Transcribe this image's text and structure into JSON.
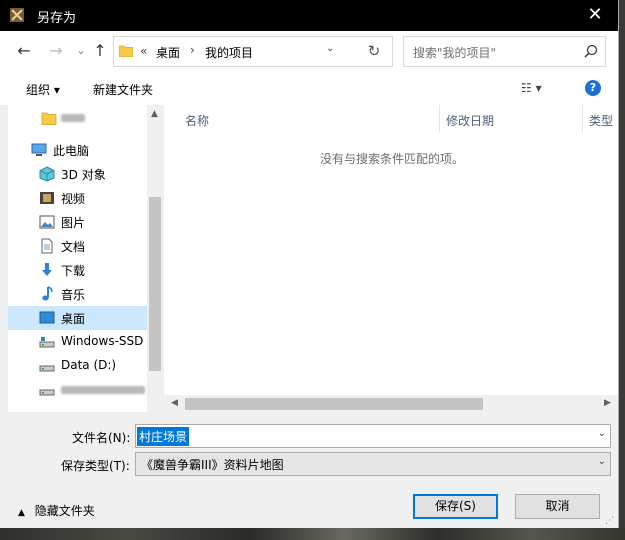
{
  "window": {
    "title": "另存为",
    "close_glyph": "✕"
  },
  "nav": {
    "back_glyph": "←",
    "forward_glyph": "→",
    "dropdown_glyph": "⌄",
    "up_glyph": "↑",
    "breadcrumb_prefix": "«",
    "crumbs": [
      "桌面",
      "我的项目"
    ],
    "crumb_sep": "›",
    "addr_dropdown_glyph": "⌄",
    "refresh_glyph": "↻",
    "search_placeholder": "搜索\"我的项目\""
  },
  "toolbar": {
    "organize": "组织 ▾",
    "new_folder": "新建文件夹",
    "view_glyph": "☷ ▾",
    "help": "?"
  },
  "sidebar": {
    "items": [
      {
        "label": "",
        "icon": "folder-icon"
      },
      {
        "label": "此电脑",
        "icon": "computer-icon"
      },
      {
        "label": "3D 对象",
        "icon": "cube-icon"
      },
      {
        "label": "视频",
        "icon": "film-icon"
      },
      {
        "label": "图片",
        "icon": "image-icon"
      },
      {
        "label": "文档",
        "icon": "document-icon"
      },
      {
        "label": "下载",
        "icon": "download-icon"
      },
      {
        "label": "音乐",
        "icon": "music-icon"
      },
      {
        "label": "桌面",
        "icon": "desktop-icon",
        "selected": true
      },
      {
        "label": "Windows-SSD",
        "icon": "drive-icon"
      },
      {
        "label": "Data (D:)",
        "icon": "drive-icon"
      },
      {
        "label": "",
        "icon": "drive-icon"
      }
    ]
  },
  "files": {
    "columns": [
      "名称",
      "修改日期",
      "类型"
    ],
    "empty_message": "没有与搜索条件匹配的项。"
  },
  "form": {
    "filename_label": "文件名(N):",
    "filename_value": "村庄场景",
    "filetype_label": "保存类型(T):",
    "filetype_value": "《魔兽争霸III》资料片地图"
  },
  "footer": {
    "hide_folders": "隐藏文件夹",
    "save": "保存(S)",
    "cancel": "取消"
  },
  "colors": {
    "accent": "#0078d7",
    "selected_bg": "#cce8ff"
  }
}
